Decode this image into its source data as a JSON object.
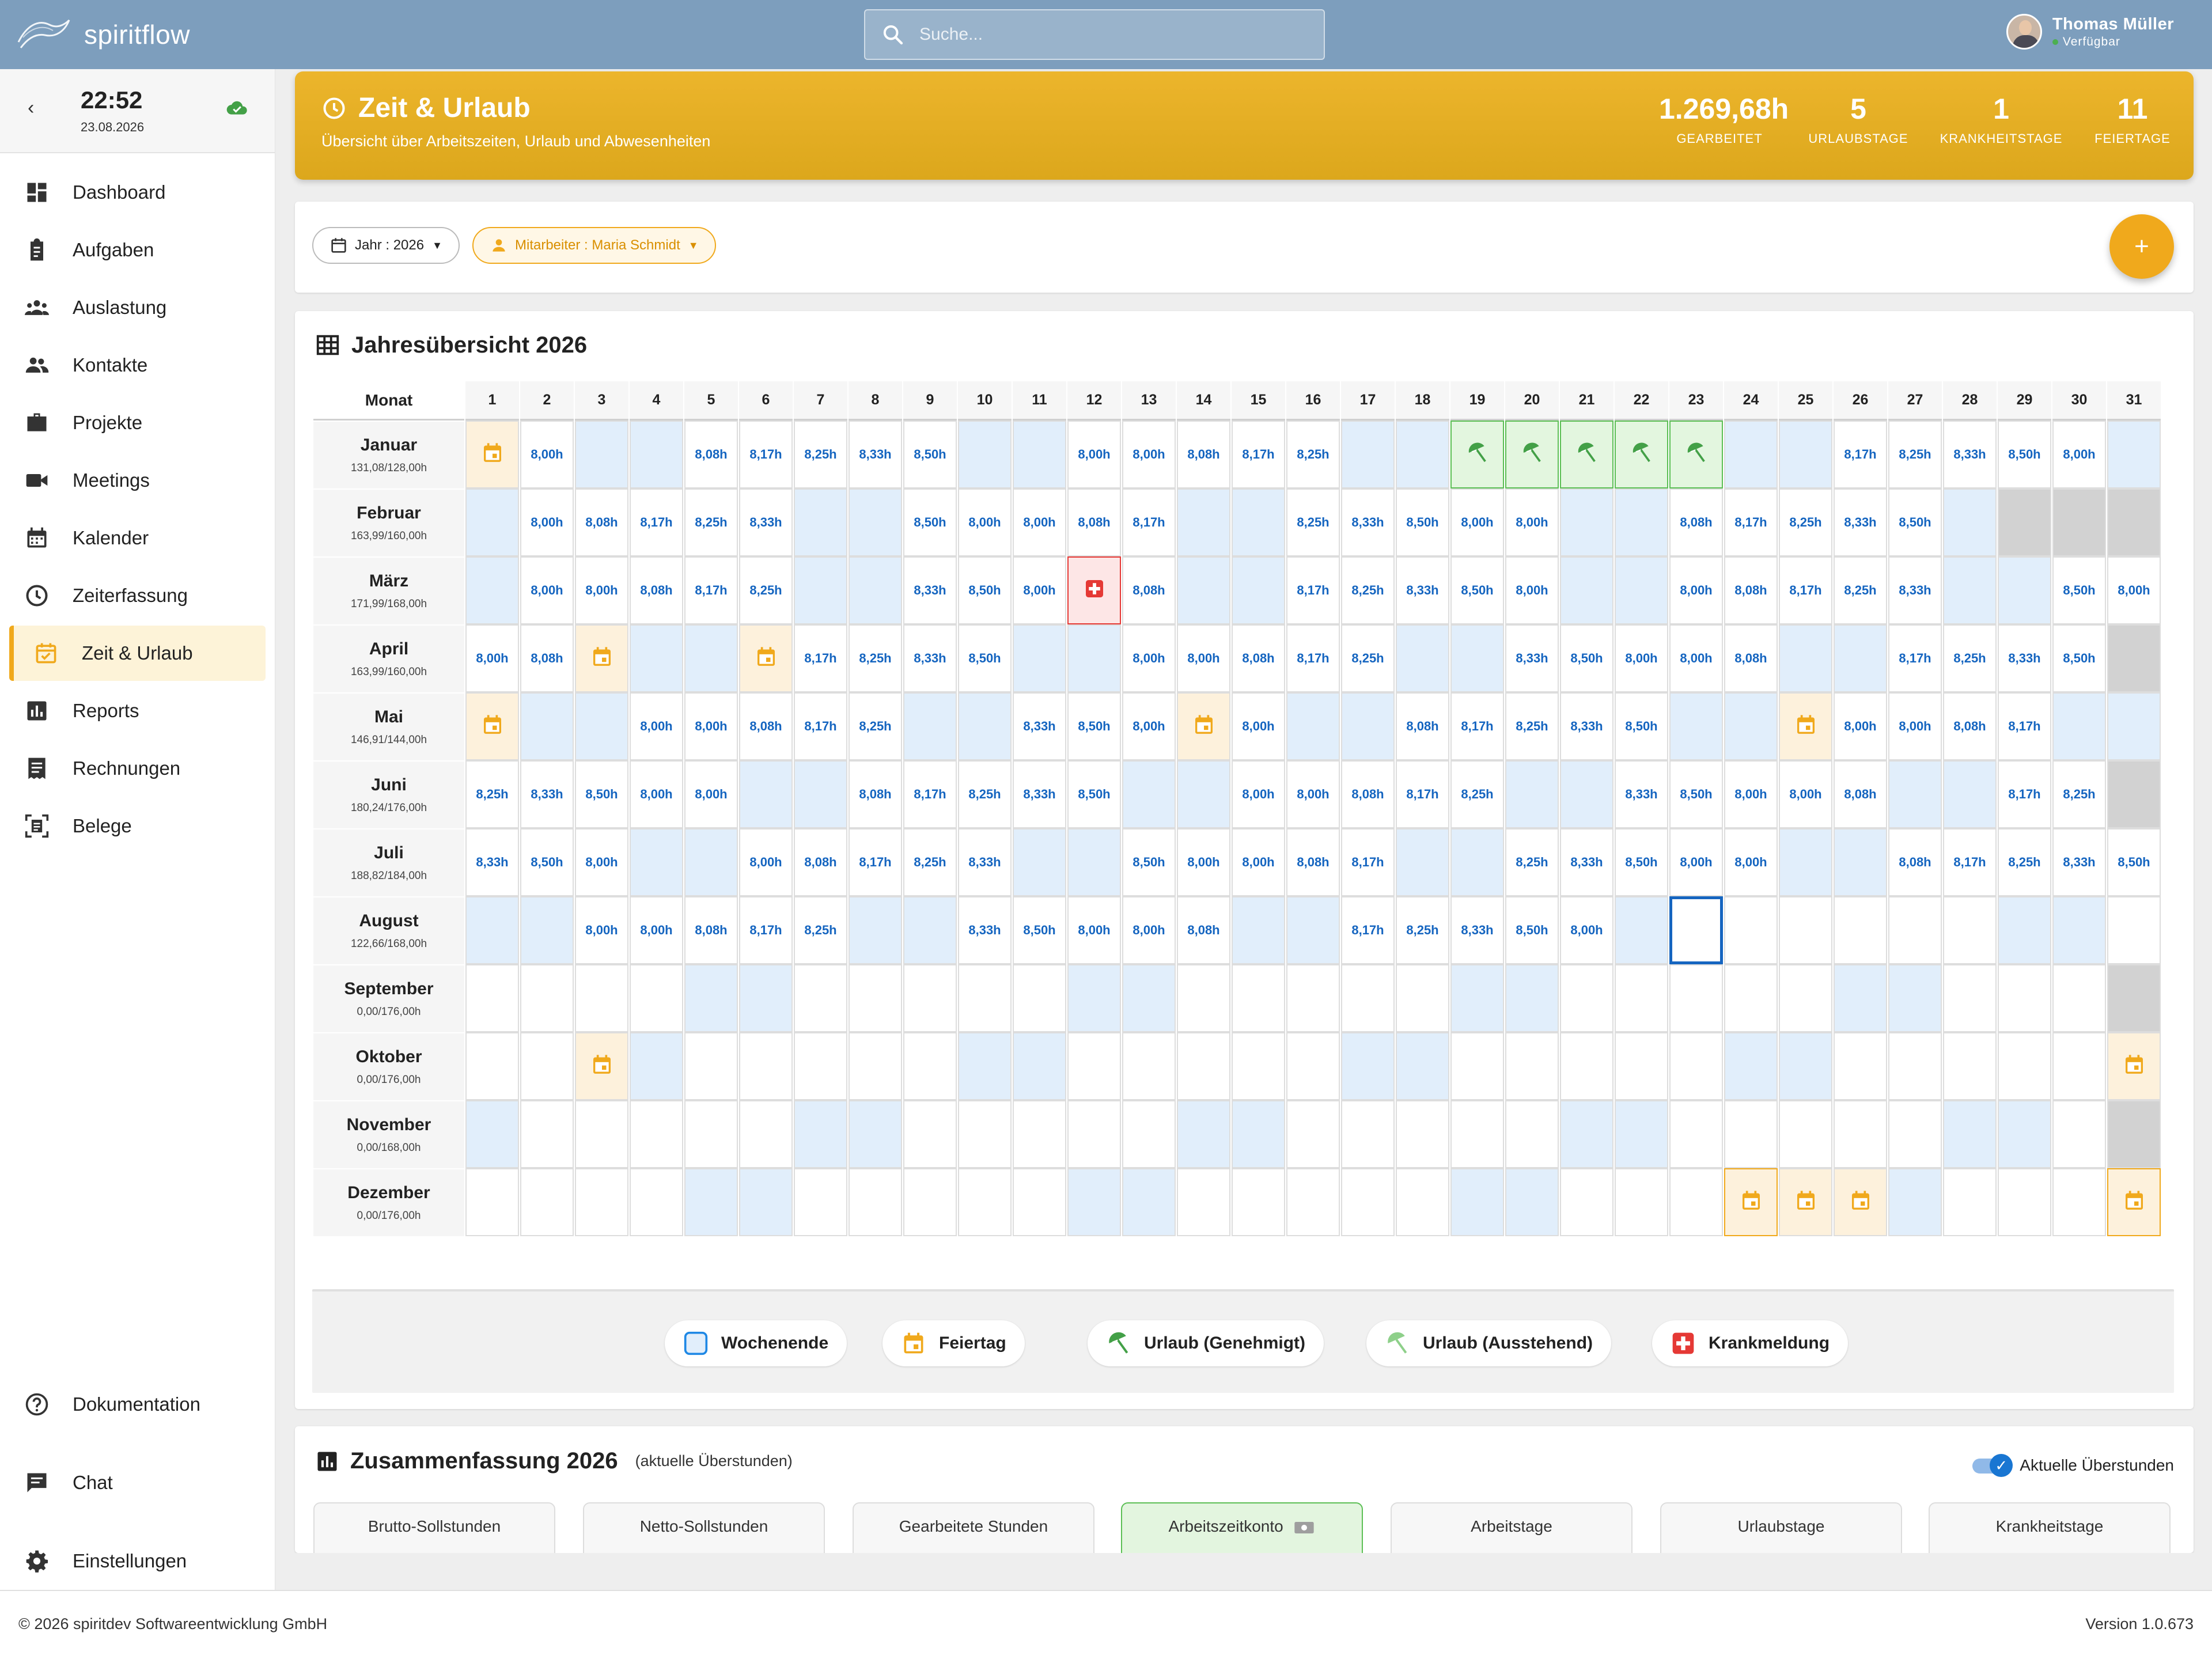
{
  "app": {
    "name": "spiritflow"
  },
  "search": {
    "placeholder": "Suche..."
  },
  "user": {
    "name": "Thomas Müller",
    "status": "Verfügbar"
  },
  "clock": {
    "time": "22:52",
    "date": "23.08.2026"
  },
  "nav": {
    "items": [
      {
        "label": "Dashboard",
        "icon": "dashboard-icon"
      },
      {
        "label": "Aufgaben",
        "icon": "clipboard-icon"
      },
      {
        "label": "Auslastung",
        "icon": "people-icon"
      },
      {
        "label": "Kontakte",
        "icon": "contacts-icon"
      },
      {
        "label": "Projekte",
        "icon": "briefcase-icon"
      },
      {
        "label": "Meetings",
        "icon": "video-icon"
      },
      {
        "label": "Kalender",
        "icon": "calendar-icon"
      },
      {
        "label": "Zeiterfassung",
        "icon": "clock-icon"
      },
      {
        "label": "Zeit & Urlaub",
        "icon": "calendar-check-icon",
        "active": true
      },
      {
        "label": "Reports",
        "icon": "bar-chart-icon"
      },
      {
        "label": "Rechnungen",
        "icon": "receipt-icon"
      },
      {
        "label": "Belege",
        "icon": "document-scan-icon"
      }
    ],
    "bottom": [
      {
        "label": "Dokumentation",
        "icon": "help-icon"
      },
      {
        "label": "Chat",
        "icon": "chat-icon"
      },
      {
        "label": "Einstellungen",
        "icon": "gear-icon"
      }
    ]
  },
  "header": {
    "title": "Zeit & Urlaub",
    "subtitle": "Übersicht über Arbeitszeiten, Urlaub und Abwesenheiten",
    "stats": [
      {
        "value": "1.269,68h",
        "label": "GEARBEITET"
      },
      {
        "value": "5",
        "label": "URLAUBSTAGE"
      },
      {
        "value": "1",
        "label": "KRANKHEITSTAGE"
      },
      {
        "value": "11",
        "label": "FEIERTAGE"
      }
    ]
  },
  "filters": {
    "year": "Jahr : 2026",
    "employee": "Mitarbeiter : Maria Schmidt",
    "add_label": "+"
  },
  "year_overview": {
    "title": "Jahresübersicht 2026",
    "month_header": "Monat",
    "days": [
      "1",
      "2",
      "3",
      "4",
      "5",
      "6",
      "7",
      "8",
      "9",
      "10",
      "11",
      "12",
      "13",
      "14",
      "15",
      "16",
      "17",
      "18",
      "19",
      "20",
      "21",
      "22",
      "23",
      "24",
      "25",
      "26",
      "27",
      "28",
      "29",
      "30",
      "31"
    ],
    "months": [
      {
        "name": "Januar",
        "hours": "131,08/128,00h",
        "cells": [
          "H",
          "8,00h",
          "W",
          "W",
          "8,08h",
          "8,17h",
          "8,25h",
          "8,33h",
          "8,50h",
          "W",
          "W",
          "8,00h",
          "8,00h",
          "8,08h",
          "8,17h",
          "8,25h",
          "W",
          "W",
          "V",
          "V",
          "V",
          "V",
          "V",
          "W",
          "W",
          "8,17h",
          "8,25h",
          "8,33h",
          "8,50h",
          "8,00h",
          "W"
        ]
      },
      {
        "name": "Februar",
        "hours": "163,99/160,00h",
        "cells": [
          "W",
          "8,00h",
          "8,08h",
          "8,17h",
          "8,25h",
          "8,33h",
          "W",
          "W",
          "8,50h",
          "8,00h",
          "8,00h",
          "8,08h",
          "8,17h",
          "W",
          "W",
          "8,25h",
          "8,33h",
          "8,50h",
          "8,00h",
          "8,00h",
          "W",
          "W",
          "8,08h",
          "8,17h",
          "8,25h",
          "8,33h",
          "8,50h",
          "W",
          "X",
          "X",
          "X"
        ]
      },
      {
        "name": "März",
        "hours": "171,99/168,00h",
        "cells": [
          "W",
          "8,00h",
          "8,00h",
          "8,08h",
          "8,17h",
          "8,25h",
          "W",
          "W",
          "8,33h",
          "8,50h",
          "8,00h",
          "S",
          "8,08h",
          "W",
          "W",
          "8,17h",
          "8,25h",
          "8,33h",
          "8,50h",
          "8,00h",
          "W",
          "W",
          "8,00h",
          "8,08h",
          "8,17h",
          "8,25h",
          "8,33h",
          "W",
          "W",
          "8,50h",
          "8,00h"
        ]
      },
      {
        "name": "April",
        "hours": "163,99/160,00h",
        "cells": [
          "8,00h",
          "8,08h",
          "H",
          "W",
          "W",
          "H",
          "8,17h",
          "8,25h",
          "8,33h",
          "8,50h",
          "W",
          "W",
          "8,00h",
          "8,00h",
          "8,08h",
          "8,17h",
          "8,25h",
          "W",
          "W",
          "8,33h",
          "8,50h",
          "8,00h",
          "8,00h",
          "8,08h",
          "W",
          "W",
          "8,17h",
          "8,25h",
          "8,33h",
          "8,50h",
          "X"
        ]
      },
      {
        "name": "Mai",
        "hours": "146,91/144,00h",
        "cells": [
          "H",
          "W",
          "W",
          "8,00h",
          "8,00h",
          "8,08h",
          "8,17h",
          "8,25h",
          "W",
          "W",
          "8,33h",
          "8,50h",
          "8,00h",
          "H",
          "8,00h",
          "W",
          "W",
          "8,08h",
          "8,17h",
          "8,25h",
          "8,33h",
          "8,50h",
          "W",
          "W",
          "H",
          "8,00h",
          "8,00h",
          "8,08h",
          "8,17h",
          "W",
          "W"
        ]
      },
      {
        "name": "Juni",
        "hours": "180,24/176,00h",
        "cells": [
          "8,25h",
          "8,33h",
          "8,50h",
          "8,00h",
          "8,00h",
          "W",
          "W",
          "8,08h",
          "8,17h",
          "8,25h",
          "8,33h",
          "8,50h",
          "W",
          "W",
          "8,00h",
          "8,00h",
          "8,08h",
          "8,17h",
          "8,25h",
          "W",
          "W",
          "8,33h",
          "8,50h",
          "8,00h",
          "8,00h",
          "8,08h",
          "W",
          "W",
          "8,17h",
          "8,25h",
          "X"
        ]
      },
      {
        "name": "Juli",
        "hours": "188,82/184,00h",
        "cells": [
          "8,33h",
          "8,50h",
          "8,00h",
          "W",
          "W",
          "8,00h",
          "8,08h",
          "8,17h",
          "8,25h",
          "8,33h",
          "W",
          "W",
          "8,50h",
          "8,00h",
          "8,00h",
          "8,08h",
          "8,17h",
          "W",
          "W",
          "8,25h",
          "8,33h",
          "8,50h",
          "8,00h",
          "8,00h",
          "W",
          "W",
          "8,08h",
          "8,17h",
          "8,25h",
          "8,33h",
          "8,50h"
        ]
      },
      {
        "name": "August",
        "hours": "122,66/168,00h",
        "cells": [
          "W",
          "W",
          "8,00h",
          "8,00h",
          "8,08h",
          "8,17h",
          "8,25h",
          "W",
          "W",
          "8,33h",
          "8,50h",
          "8,00h",
          "8,00h",
          "8,08h",
          "W",
          "W",
          "8,17h",
          "8,25h",
          "8,33h",
          "8,50h",
          "8,00h",
          "W",
          "T",
          "",
          "",
          "",
          "",
          "",
          "W",
          "W",
          ""
        ]
      },
      {
        "name": "September",
        "hours": "0,00/176,00h",
        "cells": [
          "",
          "",
          "",
          "",
          "W",
          "W",
          "",
          "",
          "",
          "",
          "",
          "W",
          "W",
          "",
          "",
          "",
          "",
          "",
          "W",
          "W",
          "",
          "",
          "",
          "",
          "",
          "W",
          "W",
          "",
          "",
          "",
          "X"
        ]
      },
      {
        "name": "Oktober",
        "hours": "0,00/176,00h",
        "cells": [
          "",
          "",
          "H",
          "W",
          "",
          "",
          "",
          "",
          "",
          "W",
          "W",
          "",
          "",
          "",
          "",
          "",
          "W",
          "W",
          "",
          "",
          "",
          "",
          "",
          "W",
          "W",
          "",
          "",
          "",
          "",
          "",
          "H"
        ]
      },
      {
        "name": "November",
        "hours": "0,00/168,00h",
        "cells": [
          "W",
          "",
          "",
          "",
          "",
          "",
          "W",
          "W",
          "",
          "",
          "",
          "",
          "",
          "W",
          "W",
          "",
          "",
          "",
          "",
          "",
          "W",
          "W",
          "",
          "",
          "",
          "",
          "",
          "W",
          "W",
          "",
          "X"
        ]
      },
      {
        "name": "Dezember",
        "hours": "0,00/176,00h",
        "cells": [
          "",
          "",
          "",
          "",
          "W",
          "W",
          "",
          "",
          "",
          "",
          "",
          "W",
          "W",
          "",
          "",
          "",
          "",
          "",
          "W",
          "W",
          "",
          "",
          "",
          "HB",
          "H",
          "H",
          "W",
          "",
          "",
          "",
          "HB"
        ]
      }
    ]
  },
  "legend": [
    {
      "label": "Wochenende",
      "icon": "weekend-square-icon"
    },
    {
      "label": "Feiertag",
      "icon": "holiday-calendar-icon"
    },
    {
      "label": "Urlaub (Genehmigt)",
      "icon": "umbrella-approved-icon"
    },
    {
      "label": "Urlaub (Ausstehend)",
      "icon": "umbrella-pending-icon"
    },
    {
      "label": "Krankmeldung",
      "icon": "sick-cross-icon"
    }
  ],
  "summary": {
    "title": "Zusammenfassung 2026",
    "subtitle": "(aktuelle Überstunden)",
    "toggle_label": "Aktuelle Überstunden",
    "tabs": [
      "Brutto-Sollstunden",
      "Netto-Sollstunden",
      "Gearbeitete Stunden",
      "Arbeitszeitkonto",
      "Arbeitstage",
      "Urlaubstage",
      "Krankheitstage"
    ]
  },
  "colors": {
    "accent": "#f0a91c",
    "topbar": "#7d9ebd",
    "hours_text": "#1565c0",
    "weekend": "#e1eefb",
    "vacation": "#5cbf55",
    "sick": "#e53935"
  },
  "footer": {
    "copyright": "© 2026 spiritdev Softwareentwicklung GmbH",
    "version": "Version 1.0.673"
  }
}
